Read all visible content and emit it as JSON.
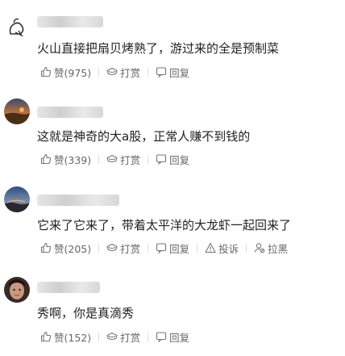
{
  "comments": [
    {
      "text": "火山直接把扇贝烤熟了，游过来的全是预制菜",
      "like": "赞(975)",
      "tip": "打赏",
      "reply": "回复"
    },
    {
      "text": "这就是神奇的大a股，正常人赚不到钱的",
      "like": "赞(339)",
      "tip": "打赏",
      "reply": "回复"
    },
    {
      "text": "它来了它来了，带着太平洋的大龙虾一起回来了",
      "like": "赞(205)",
      "tip": "打赏",
      "reply": "回复",
      "report": "投诉",
      "block": "拉黑"
    },
    {
      "text": "秀啊，你是真滴秀",
      "like": "赞(152)",
      "tip": "打赏",
      "reply": "回复"
    }
  ]
}
